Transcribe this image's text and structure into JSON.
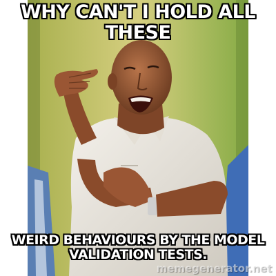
{
  "meme": {
    "top_caption": "WHY CAN'T I HOLD ALL THESE",
    "bottom_caption": "WEIRD BEHAVIOURS BY THE MODEL VALIDATION TESTS.",
    "watermark": "memegenerator.net"
  },
  "colors": {
    "caption_fill": "#ffffff",
    "caption_stroke": "#000000",
    "background_left": "#c9c26a",
    "background_right": "#8fb34a",
    "shirt": "#ece8e0",
    "skin": "#a0603a"
  }
}
